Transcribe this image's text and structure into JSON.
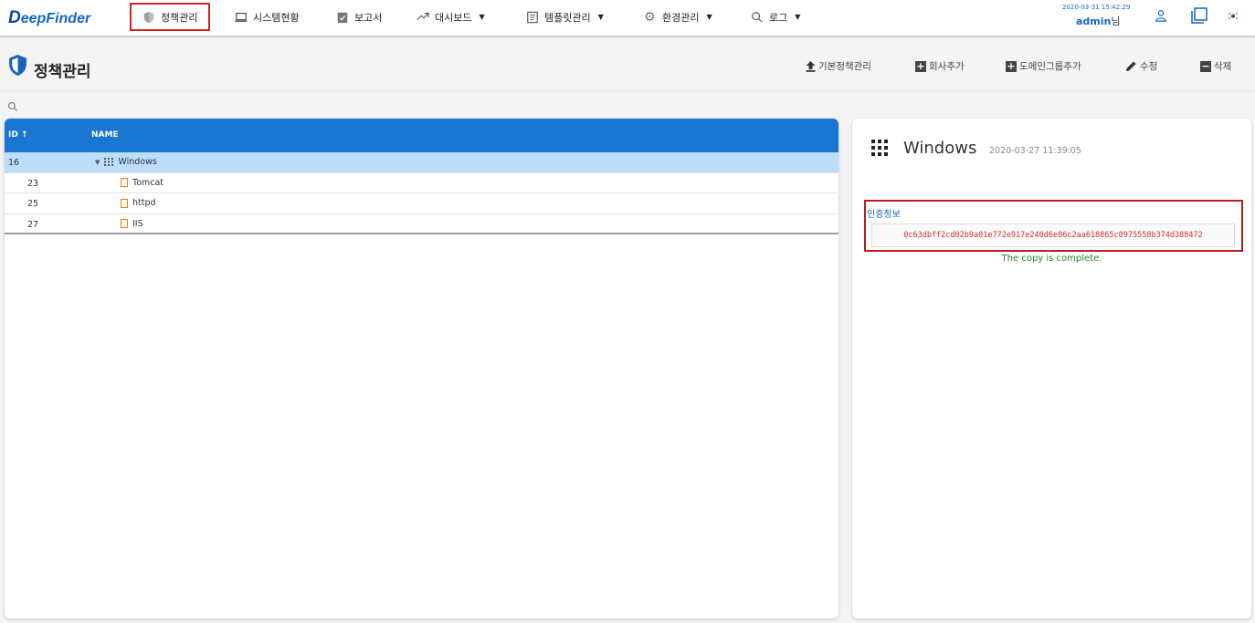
{
  "brand": {
    "logo_initial": "D",
    "logo_rest": "eepFinder"
  },
  "nav": {
    "items": [
      {
        "label": "정책관리",
        "icon": "shield-icon",
        "active": true
      },
      {
        "label": "시스템현황",
        "icon": "laptop-icon"
      },
      {
        "label": "보고서",
        "icon": "clipboard-icon"
      },
      {
        "label": "대시보드",
        "icon": "trend-icon",
        "dropdown": true
      },
      {
        "label": "템플릿관리",
        "icon": "document-icon",
        "dropdown": true
      },
      {
        "label": "환경관리",
        "icon": "gear-icon",
        "dropdown": true
      },
      {
        "label": "로그",
        "icon": "search-icon",
        "dropdown": true
      }
    ]
  },
  "user": {
    "datetime": "2020-03-31 15:42:29",
    "name": "admin",
    "suffix": "님"
  },
  "page": {
    "title": "정책관리",
    "actions": {
      "base_policy": "기본정책관리",
      "add_company": "회사추가",
      "add_domain_group": "도메인그룹추가",
      "edit": "수정",
      "delete": "삭제"
    }
  },
  "table": {
    "columns": {
      "id": "ID",
      "name": "NAME"
    },
    "rows": [
      {
        "id": "16",
        "name": "Windows"
      },
      {
        "id": "23",
        "name": "Tomcat"
      },
      {
        "id": "25",
        "name": "httpd"
      },
      {
        "id": "27",
        "name": "IIS"
      }
    ]
  },
  "detail": {
    "title": "Windows",
    "date": "2020-03-27 11:39:05",
    "auth_label": "인증정보",
    "auth_key": "0c63dbff2cd02b9a01e772e917e240d6e86c2aa618865c0975558b374d388472",
    "copy_message": "The copy is complete."
  },
  "colors": {
    "accent": "#1976d2",
    "highlight": "#c62828",
    "success": "#2e7d32"
  }
}
